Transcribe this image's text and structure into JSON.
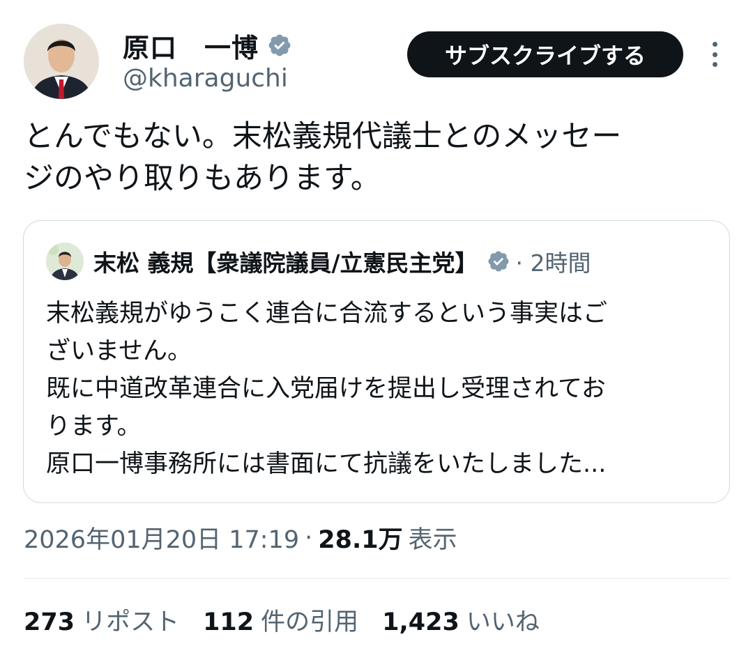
{
  "author": {
    "name": "原口　一博",
    "handle": "@kharaguchi",
    "verified_color": "#829aab"
  },
  "actions": {
    "subscribe_label": "サブスクライブする",
    "more_icon": "more-vertical-icon"
  },
  "tweet": {
    "lines": [
      "とんでもない。末松義規代議士とのメッセー",
      "ジのやり取りもあります。"
    ]
  },
  "quoted": {
    "name": "末松 義規【衆議院議員/立憲民主党】",
    "meta": "· 2時間",
    "lines": [
      "末松義規がゆうこく連合に合流するという事実はご",
      "ざいません。",
      "既に中道改革連合に入党届けを提出し受理されてお",
      "ります。",
      "原口一博事務所には書面にて抗議をいたしました..."
    ]
  },
  "timestamp": {
    "date": "2026年01月20日 17:19",
    "separator": "·",
    "views": "28.1万",
    "views_label": "表示"
  },
  "stats": {
    "reposts": "273",
    "reposts_label": "リポスト",
    "quotes": "112",
    "quotes_label": "件の引用",
    "likes": "1,423",
    "likes_label": "いいね"
  },
  "colors": {
    "text": "#0f1419",
    "secondary": "#536471",
    "border": "#cfd9de",
    "button_bg": "#0f1419"
  }
}
